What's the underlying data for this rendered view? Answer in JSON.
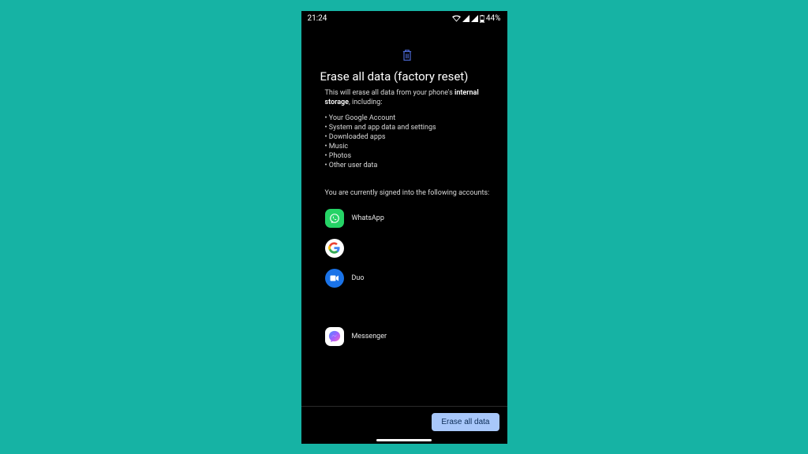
{
  "statusbar": {
    "time": "21:24",
    "battery_text": "44%"
  },
  "page": {
    "title": "Erase all data (factory reset)",
    "desc_pre": "This will erase all data from your phone's ",
    "desc_bold": "internal storage",
    "desc_post": ", including:",
    "bullets": [
      "Your Google Account",
      "System and app data and settings",
      "Downloaded apps",
      "Music",
      "Photos",
      "Other user data"
    ],
    "signed_in_text": "You are currently signed into the following accounts:"
  },
  "accounts": [
    {
      "name": "WhatsApp"
    },
    {
      "name": ""
    },
    {
      "name": "Duo"
    },
    {
      "name": "Messenger"
    }
  ],
  "footer": {
    "erase_button": "Erase all data"
  }
}
